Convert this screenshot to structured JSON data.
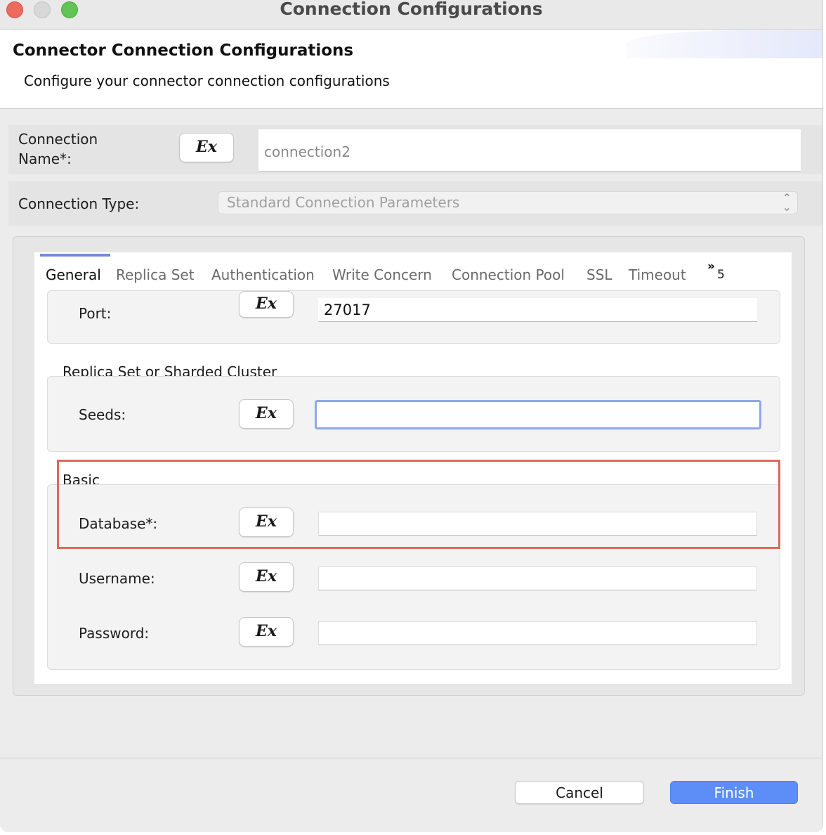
{
  "window": {
    "title": "Connection Configurations"
  },
  "banner": {
    "title": "Connector Connection Configurations",
    "subtitle": "Configure your connector connection configurations"
  },
  "connection_name": {
    "label": "Connection\nName*:",
    "ex_label": "Ex",
    "value": "connection2"
  },
  "connection_type": {
    "label": "Connection Type:",
    "value": "Standard Connection Parameters",
    "caret": "⌃⌄"
  },
  "tabs": {
    "items": [
      {
        "label": "General",
        "active": true
      },
      {
        "label": "Replica Set"
      },
      {
        "label": "Authentication"
      },
      {
        "label": "Write Concern"
      },
      {
        "label": "Connection Pool"
      },
      {
        "label": "SSL"
      },
      {
        "label": "Timeout"
      }
    ],
    "overflow_icon": "»",
    "overflow_count": "5"
  },
  "general": {
    "port": {
      "label": "Port:",
      "ex_label": "Ex",
      "value": "27017"
    },
    "replica_group": "Replica Set or Sharded Cluster",
    "seeds": {
      "label": "Seeds:",
      "ex_label": "Ex",
      "value": ""
    },
    "basic_group": "Basic",
    "database": {
      "label": "Database*:",
      "ex_label": "Ex",
      "value": ""
    },
    "username": {
      "label": "Username:",
      "ex_label": "Ex",
      "value": ""
    },
    "password": {
      "label": "Password:",
      "ex_label": "Ex",
      "value": ""
    }
  },
  "footer": {
    "cancel_label": "Cancel",
    "finish_label": "Finish"
  },
  "colors": {
    "accent": "#5d8ef7",
    "highlight": "#dc6a59",
    "focus": "#8fa7ea"
  }
}
